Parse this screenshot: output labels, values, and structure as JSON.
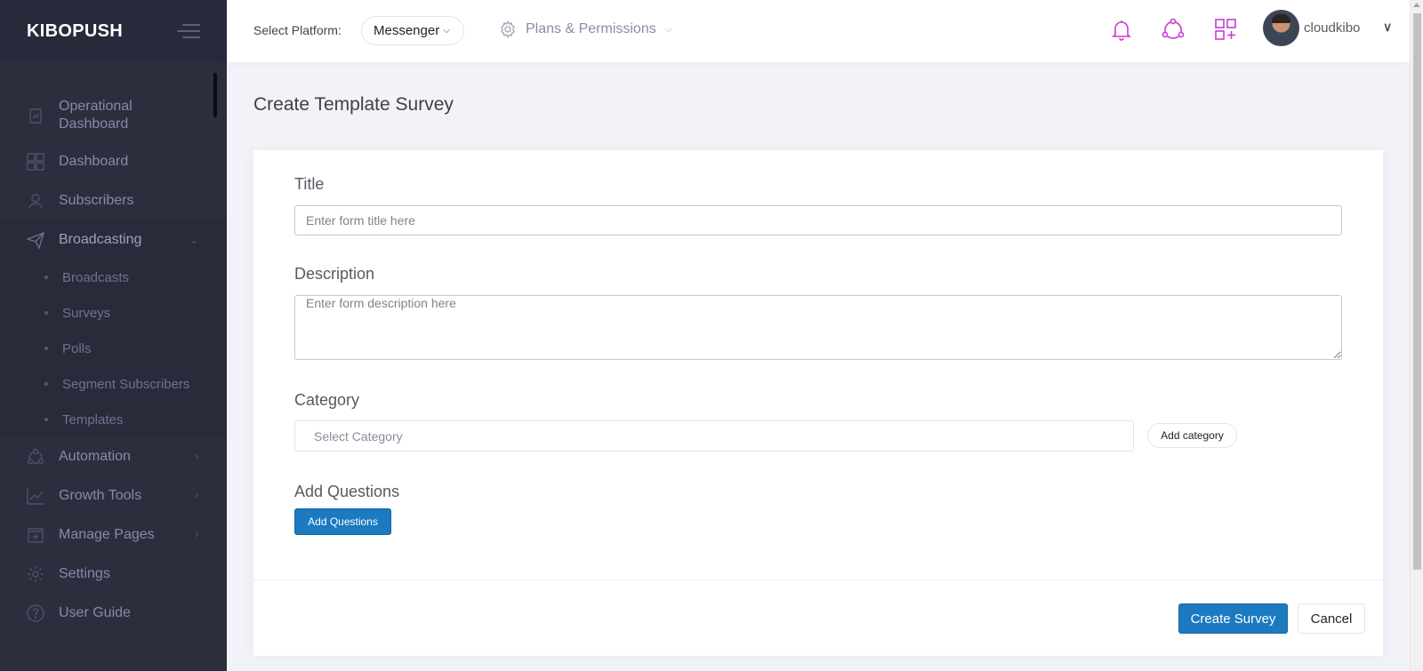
{
  "sidebar": {
    "brand": "KIBOPUSH",
    "items": [
      {
        "label": "Operational Dashboard",
        "icon": "chart-clipboard-icon"
      },
      {
        "label": "Dashboard",
        "icon": "grid-icon"
      },
      {
        "label": "Subscribers",
        "icon": "user-icon"
      },
      {
        "label": "Broadcasting",
        "icon": "paper-plane-icon",
        "expanded": true
      },
      {
        "label": "Automation",
        "icon": "share-icon"
      },
      {
        "label": "Growth Tools",
        "icon": "line-chart-icon"
      },
      {
        "label": "Manage Pages",
        "icon": "add-page-icon"
      },
      {
        "label": "Settings",
        "icon": "gear-icon"
      },
      {
        "label": "User Guide",
        "icon": "help-icon"
      }
    ],
    "broadcasting_sub": [
      "Broadcasts",
      "Surveys",
      "Polls",
      "Segment Subscribers",
      "Templates"
    ]
  },
  "header": {
    "platform_label": "Select Platform:",
    "platform_value": "Messenger",
    "plans_label": "Plans & Permissions",
    "user_name": "cloudkibo",
    "icon_color": "#c73cd1"
  },
  "page": {
    "title": "Create Template Survey"
  },
  "form": {
    "title_label": "Title",
    "title_placeholder": "Enter form title here",
    "description_label": "Description",
    "description_placeholder": "Enter form description here",
    "category_label": "Category",
    "category_placeholder": "Select Category",
    "add_category": "Add category",
    "questions_label": "Add Questions",
    "add_questions_button": "Add Questions",
    "create_button": "Create Survey",
    "cancel_button": "Cancel"
  }
}
